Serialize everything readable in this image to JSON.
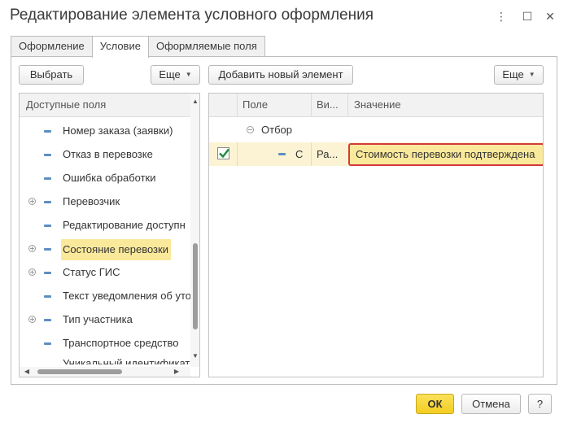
{
  "window": {
    "title": "Редактирование элемента условного оформления",
    "more_icon": "⋮",
    "maximize_icon": "☐",
    "close_icon": "✕"
  },
  "tabs": [
    {
      "label": "Оформление"
    },
    {
      "label": "Условие",
      "active": true
    },
    {
      "label": "Оформляемые поля"
    }
  ],
  "left": {
    "select_button": "Выбрать",
    "more_button": "Еще",
    "header": "Доступные поля",
    "items": [
      {
        "label": "Номер заказа (заявки)",
        "expandable": false
      },
      {
        "label": "Отказ в перевозке",
        "expandable": false
      },
      {
        "label": "Ошибка обработки",
        "expandable": false
      },
      {
        "label": "Перевозчик",
        "expandable": true
      },
      {
        "label": "Редактирование доступн",
        "expandable": false
      },
      {
        "label": "Состояние перевозки",
        "expandable": true,
        "selected": true
      },
      {
        "label": "Статус ГИС",
        "expandable": true
      },
      {
        "label": "Текст уведомления об уто",
        "expandable": false
      },
      {
        "label": "Тип участника",
        "expandable": true
      },
      {
        "label": "Транспортное средство",
        "expandable": false
      },
      {
        "label": "Уникальный идентификато",
        "expandable": false
      }
    ]
  },
  "right": {
    "add_button": "Добавить новый элемент",
    "more_button": "Еще",
    "columns": {
      "field": "Поле",
      "view": "Ви...",
      "value": "Значение"
    },
    "group": {
      "label": "Отбор"
    },
    "row": {
      "checked": true,
      "field": "С",
      "view": "Ра...",
      "value": "Стоимость перевозки подтверждена"
    }
  },
  "footer": {
    "ok": "ОК",
    "cancel": "Отмена",
    "help": "?"
  },
  "colors": {
    "accent_yellow": "#fbe99b",
    "ok_yellow": "#f5d430",
    "highlight_border": "#d43a3a",
    "check_green": "#1e8a3c",
    "field_dash": "#5b8ec2"
  }
}
